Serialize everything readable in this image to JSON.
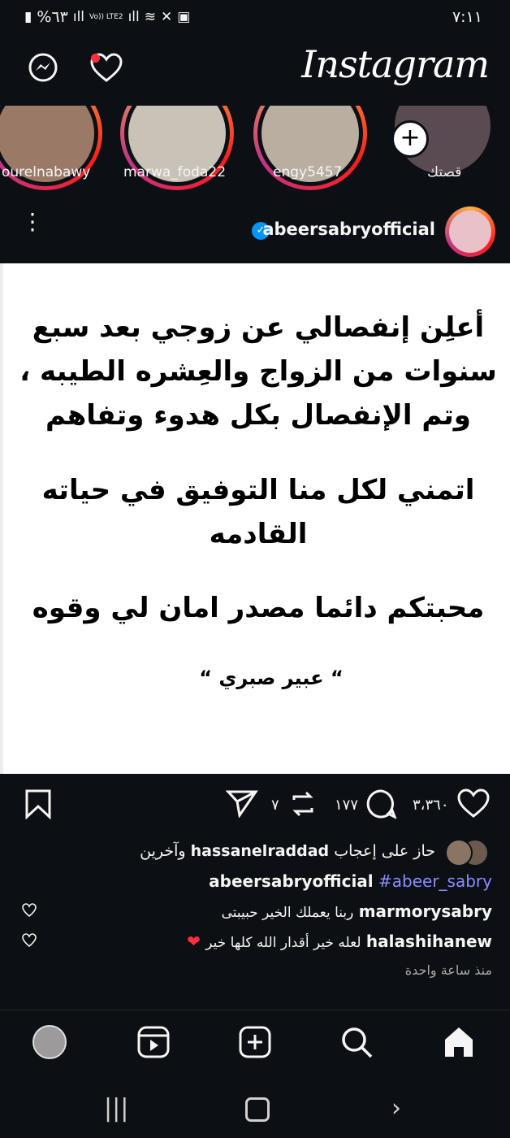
{
  "status": {
    "time": "٧:١١",
    "battery": "%٦٣",
    "network_label": "Vo)) LTE2"
  },
  "header": {
    "logo": "Instagram",
    "chevron": "⌄"
  },
  "stories": [
    {
      "name": "ourelnabawy"
    },
    {
      "name": "marwa_foda22"
    },
    {
      "name": "engy5457"
    },
    {
      "name": "قصتك"
    }
  ],
  "post": {
    "username": "abeersabryofficial",
    "image_lines": {
      "block1": "أعلِن  إنفصالي عن زوجي بعد سبع\nسنوات من  الزواج والعِشره الطيبه ،\nوتم الإنفصال  بكل هدوء وتفاهم",
      "block2": "اتمني لكل منا التوفيق في حياته\nالقادمه",
      "block3": "محبتكم دائما مصدر امان لي وقوه",
      "signature": "“ عبير صبري “"
    },
    "likes_count": "٣،٣٦٠",
    "comments_count": "١٧٧",
    "reposts_count": "٧",
    "liked_by_prefix": "حاز على إعجاب",
    "liked_by_user": "hassanelraddad",
    "liked_by_suffix": "وآخرين",
    "caption_user": "abeersabryofficial",
    "caption_tag": "#abeer_sabry",
    "comments": [
      {
        "user": "marmorysabry",
        "text": "ربنا يعملك الخير حبيبتى"
      },
      {
        "user": "halashihanew",
        "text": "لعله خير أقدار الله كلها خير"
      }
    ],
    "time_ago": "منذ ساعة واحدة"
  },
  "colors": {
    "accent_blue": "#0095f6",
    "notif_red": "#ff3040",
    "tag_color": "#8b8cff"
  }
}
